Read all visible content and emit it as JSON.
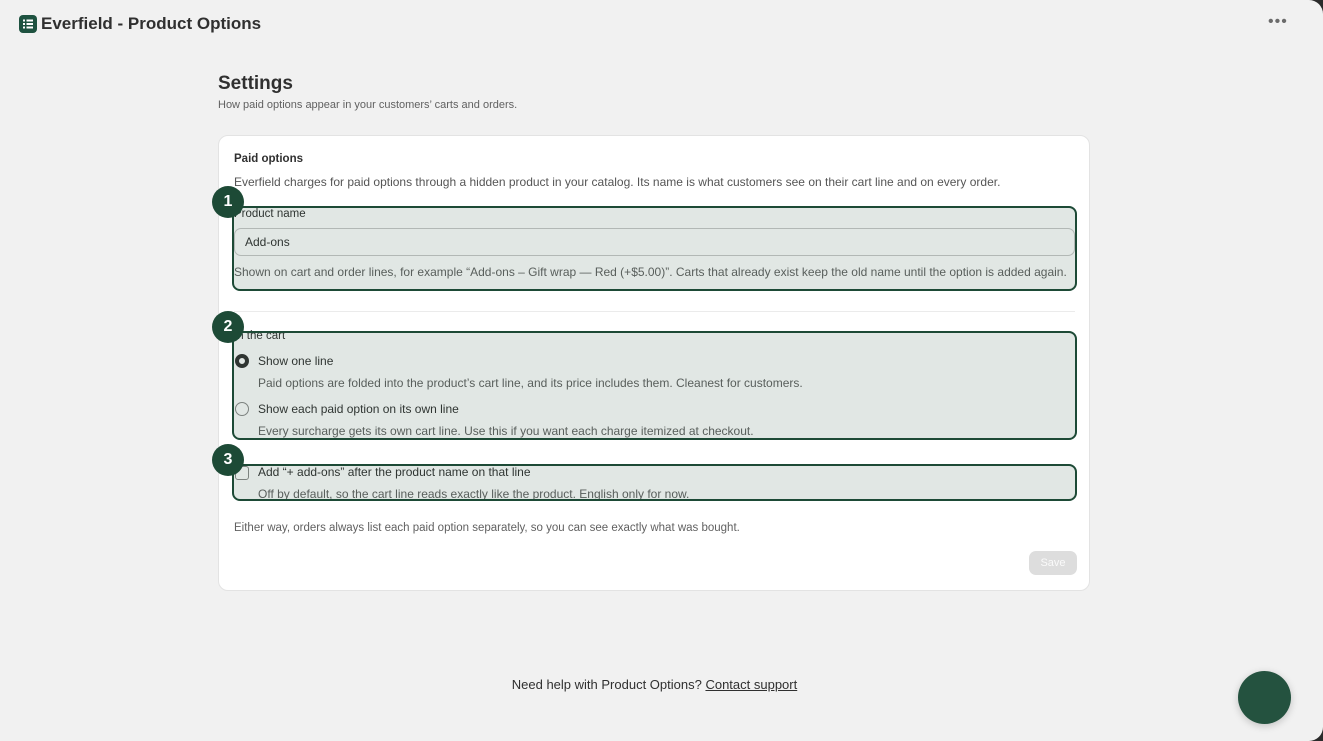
{
  "app": {
    "title": "Everfield - Product Options"
  },
  "page": {
    "title": "Settings",
    "subtitle": "How paid options appear in your customers’ carts and orders."
  },
  "card": {
    "heading": "Paid options",
    "description": "Everfield charges for paid options through a hidden product in your catalog. Its name is what customers see on their cart line and on every order.",
    "product_name": {
      "label": "Product name",
      "value": "Add-ons",
      "help": "Shown on cart and order lines, for example “Add-ons – Gift wrap — Red (+$5.00)”. Carts that already exist keep the old name until the option is added again."
    },
    "cart_group": {
      "label": "In the cart",
      "options": [
        {
          "label": "Show one line",
          "help": "Paid options are folded into the product’s cart line, and its price includes them. Cleanest for customers.",
          "checked": true
        },
        {
          "label": "Show each paid option on its own line",
          "help": "Every surcharge gets its own cart line. Use this if you want each charge itemized at checkout.",
          "checked": false
        }
      ]
    },
    "addon_suffix": {
      "label": "Add “+ add-ons” after the product name on that line",
      "help": "Off by default, so the cart line reads exactly like the product. English only for now.",
      "checked": false
    },
    "footnote": "Either way, orders always list each paid option separately, so you can see exactly what was bought.",
    "save_label": "Save"
  },
  "badges": [
    "1",
    "2",
    "3"
  ],
  "footer": {
    "text": "Need help with Product Options?",
    "link": "Contact support"
  },
  "colors": {
    "accent": "#1d4a36",
    "highlight_fill": "#dde3df",
    "chat_button": "#24523f"
  }
}
